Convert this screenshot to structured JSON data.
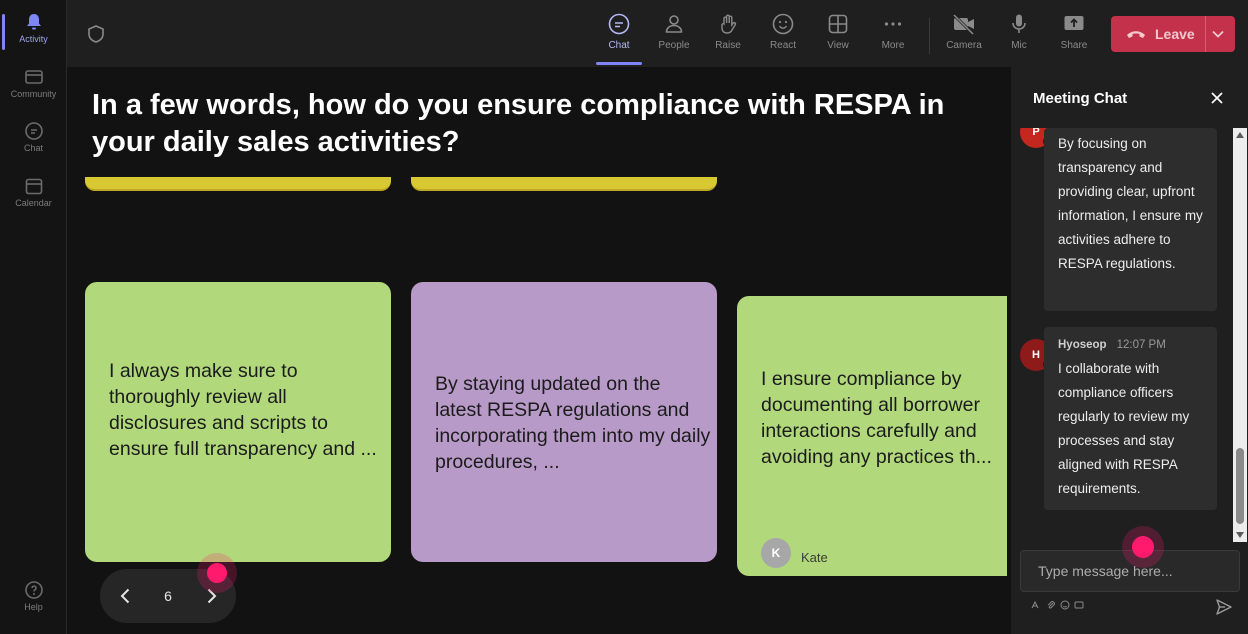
{
  "rail": {
    "items": [
      {
        "label": "Activity",
        "active": true
      },
      {
        "label": "Community"
      },
      {
        "label": "Chat"
      },
      {
        "label": "Calendar"
      },
      {
        "label": "Help"
      }
    ]
  },
  "toolbar": {
    "chat": "Chat",
    "people": "People",
    "raise": "Raise",
    "react": "React",
    "view": "View",
    "more": "More",
    "camera": "Camera",
    "mic": "Mic",
    "share": "Share",
    "leave": "Leave"
  },
  "stage": {
    "question": "In a few words, how do you ensure compliance with RESPA in your daily sales activities?",
    "cards": [
      {
        "text": "I always make sure to thoroughly review all disclosures and scripts to ensure full transparency and ...",
        "color": "#b1d97b"
      },
      {
        "text": "By staying updated on the latest RESPA regulations and incorporating them into my daily procedures, ...",
        "color": "#b89ac8"
      },
      {
        "text": "I ensure compliance by documenting all borrower interactions carefully and avoiding any practices th...",
        "color": "#b1d97b",
        "author": "Kate",
        "author_initial": "K"
      }
    ],
    "page_number": "6"
  },
  "chat": {
    "title": "Meeting Chat",
    "messages": [
      {
        "initial": "P",
        "avatar_color": "#c4271d",
        "text": "By focusing on transparency and providing clear, upfront information, I ensure my activities adhere to RESPA regulations."
      },
      {
        "initial": "H",
        "avatar_color": "#8e1a1a",
        "sender": "Hyoseop",
        "time": "12:07 PM",
        "text": "I collaborate with compliance officers regularly to review my processes and stay aligned with RESPA requirements."
      }
    ],
    "compose_placeholder": "Type message here..."
  }
}
